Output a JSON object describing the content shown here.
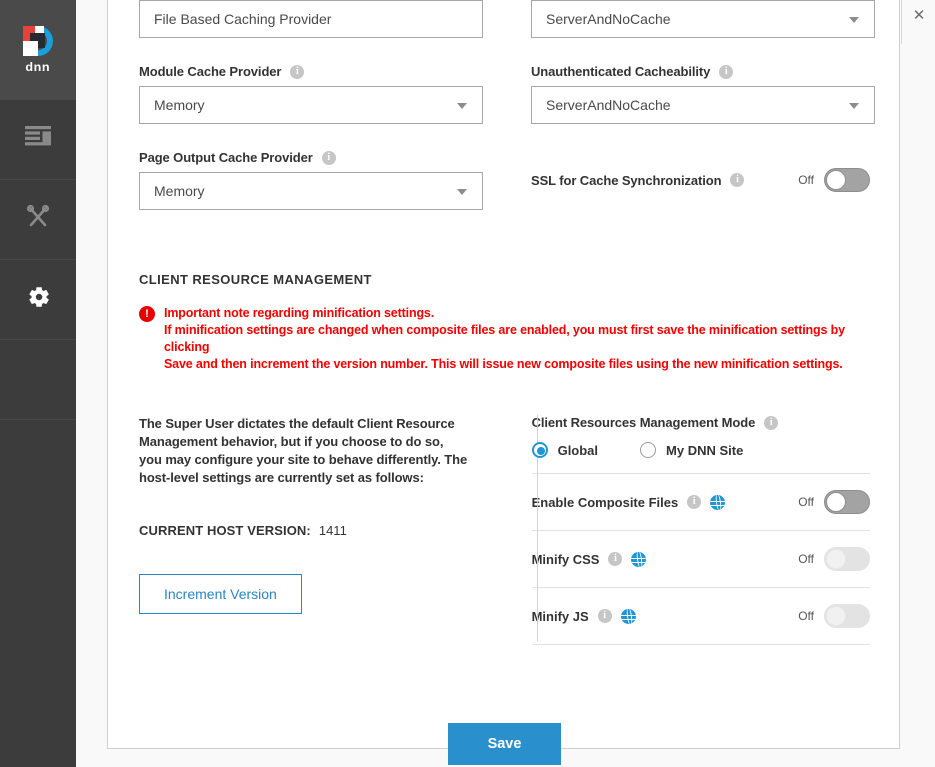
{
  "sidebar": {
    "logo": {
      "wordmark": "dnn",
      "icon": "dnn-logo-icon"
    },
    "items": [
      {
        "name": "content",
        "icon": "content-list-icon",
        "active": false
      },
      {
        "name": "tools",
        "icon": "tools-wrench-screwdriver-icon",
        "active": false
      },
      {
        "name": "settings",
        "icon": "gear-icon",
        "active": true
      }
    ]
  },
  "window": {
    "close_label": "✕"
  },
  "form": {
    "top_partial_field": {
      "label_fragment": "File Based Caching Provider",
      "value": ""
    },
    "module_cache_provider": {
      "label": "Module Cache Provider",
      "value": "Memory"
    },
    "page_output_cache_provider": {
      "label": "Page Output Cache Provider",
      "value": "Memory"
    },
    "authenticated_cacheability": {
      "value": "ServerAndNoCache"
    },
    "unauthenticated_cacheability": {
      "label": "Unauthenticated Cacheability",
      "value": "ServerAndNoCache"
    },
    "ssl_cache_sync": {
      "label": "SSL for Cache Synchronization",
      "state_label": "Off",
      "on": false
    }
  },
  "crm_section": {
    "title": "CLIENT RESOURCE MANAGEMENT",
    "warning": {
      "line1": "Important note regarding minification settings.",
      "line2": "If minification settings are changed when composite files are enabled, you must first save the minification settings by clicking",
      "line3": "Save and then increment the version number. This will issue new composite files using the new minification settings."
    },
    "blurb": "The Super User dictates the default Client Resource Management behavior, but if you choose to do so, you may configure your site to behave differently. The host-level settings are currently set as follows:",
    "host_version_label": "CURRENT HOST VERSION:",
    "host_version_value": "1411",
    "increment_button": "Increment Version",
    "mode": {
      "label": "Client Resources Management Mode",
      "options": [
        {
          "label": "Global",
          "selected": true
        },
        {
          "label": "My DNN Site",
          "selected": false
        }
      ]
    },
    "toggles": [
      {
        "label": "Enable Composite Files",
        "state_label": "Off",
        "on": false,
        "disabled": false
      },
      {
        "label": "Minify CSS",
        "state_label": "Off",
        "on": false,
        "disabled": true
      },
      {
        "label": "Minify JS",
        "state_label": "Off",
        "on": false,
        "disabled": true
      }
    ]
  },
  "footer": {
    "save_label": "Save"
  },
  "colors": {
    "accent_blue": "#2a8fcd",
    "warning_red": "#f50000",
    "sidebar_bg": "#3c3c3c",
    "globe_blue": "#2196d3"
  }
}
